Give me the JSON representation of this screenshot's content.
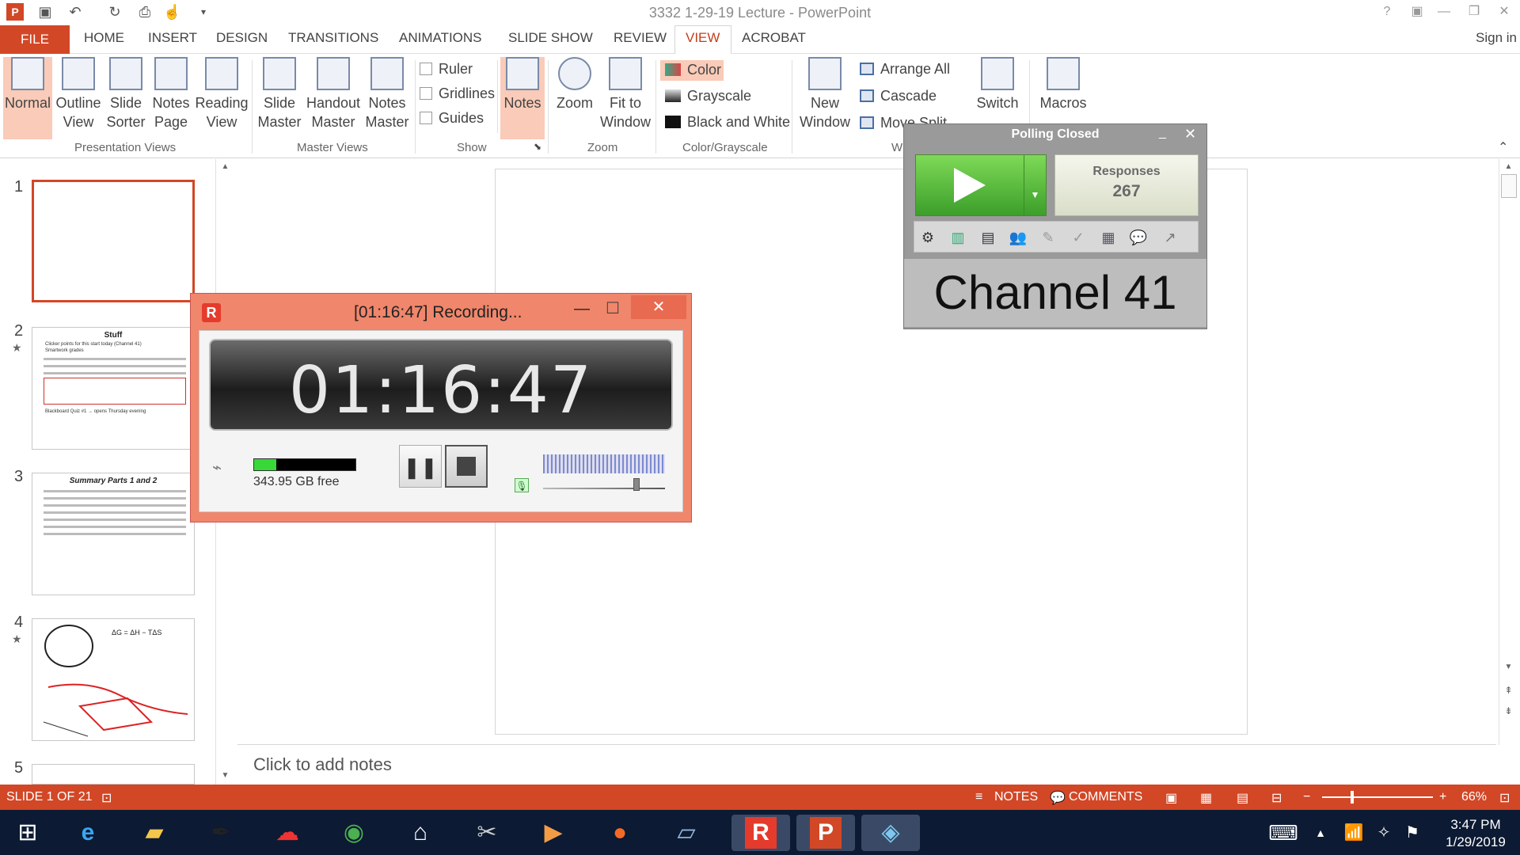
{
  "app": {
    "window_title": "3332 1-29-19 Lecture - PowerPoint",
    "sign_in": "Sign in"
  },
  "tabs": [
    "FILE",
    "HOME",
    "INSERT",
    "DESIGN",
    "TRANSITIONS",
    "ANIMATIONS",
    "SLIDE SHOW",
    "REVIEW",
    "VIEW",
    "ACROBAT"
  ],
  "ribbon": {
    "presentation_views": {
      "label": "Presentation Views",
      "normal": "Normal",
      "outline": "Outline\nView",
      "slide_sorter": "Slide\nSorter",
      "notes_page": "Notes\nPage",
      "reading_view": "Reading\nView"
    },
    "master_views": {
      "label": "Master Views",
      "slide_master": "Slide\nMaster",
      "handout_master": "Handout\nMaster",
      "notes_master": "Notes\nMaster"
    },
    "show": {
      "label": "Show",
      "ruler": "Ruler",
      "gridlines": "Gridlines",
      "guides": "Guides"
    },
    "notes": "Notes",
    "zoom": {
      "label": "Zoom",
      "zoom": "Zoom",
      "fit": "Fit to\nWindow"
    },
    "color_grayscale": {
      "label": "Color/Grayscale",
      "color": "Color",
      "grayscale": "Grayscale",
      "bw": "Black and White"
    },
    "window": {
      "label": "W",
      "new_window": "New\nWindow",
      "arrange_all": "Arrange All",
      "cascade": "Cascade",
      "move_split": "Move Split",
      "switch": "Switch"
    },
    "macros": "Macros"
  },
  "slides": [
    {
      "num": "1",
      "title": ""
    },
    {
      "num": "2",
      "title": "Stuff",
      "bullets": [
        "Clicker points for this start today (Channel 41)",
        "Smartwork grades",
        "Blackboard Quiz #1 → opens Thursday evening"
      ]
    },
    {
      "num": "3",
      "title": "Summary Parts 1 and 2"
    },
    {
      "num": "4",
      "title": ""
    },
    {
      "num": "5",
      "title": ""
    }
  ],
  "notes_placeholder": "Click to add notes",
  "status": {
    "slide_info": "SLIDE 1 OF 21",
    "notes": "NOTES",
    "comments": "COMMENTS",
    "zoom": "66%"
  },
  "recorder": {
    "title": "[01:16:47] Recording...",
    "timer": "01:16:47",
    "disk_free": "343.95 GB free",
    "disk_used_fraction": 0.22
  },
  "polling": {
    "title": "Polling Closed",
    "responses_label": "Responses",
    "responses_count": "267",
    "channel": "Channel 41"
  },
  "taskbar": {
    "time": "3:47 PM",
    "date": "1/29/2019"
  },
  "colors": {
    "accent": "#d24726",
    "taskbar": "#0c1a33",
    "recorder_frame": "#f0866b",
    "poll_green": "#4caf32"
  }
}
